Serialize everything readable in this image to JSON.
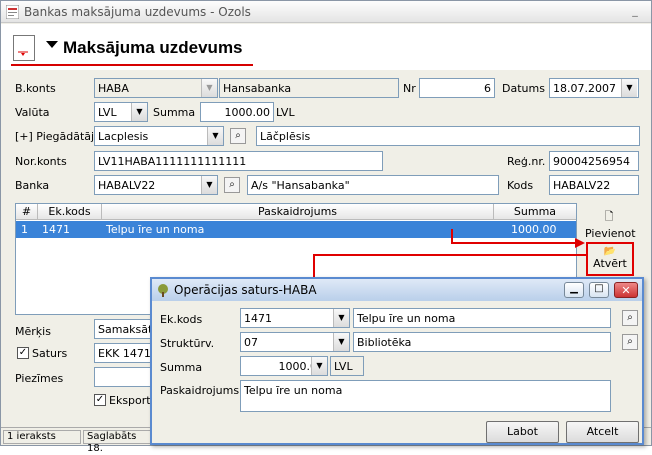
{
  "window": {
    "title": "Bankas maksājuma uzdevums - Ozols"
  },
  "header": {
    "title": "Maksājuma uzdevums"
  },
  "form": {
    "bkonts_label": "B.konts",
    "bkonts_value": "HABA",
    "bank_name": "Hansabanka",
    "nr_label": "Nr",
    "nr_value": "6",
    "datums_label": "Datums",
    "datums_value": "18.07.2007",
    "valuta_label": "Valūta",
    "valuta_value": "LVL",
    "summa_label": "Summa",
    "summa_value": "1000.00",
    "summa_currency": "LVL",
    "piegadatajs_label": "[+] Piegādātājs",
    "piegadatajs_value": "Lacplesis",
    "piegadatajs_name": "Lāčplēsis",
    "norkonts_label": "Nor.konts",
    "norkonts_value": "LV11HABA1111111111111",
    "regnr_label": "Reģ.nr.",
    "regnr_value": "90004256954",
    "banka_label": "Banka",
    "banka_value": "HABALV22",
    "banka_name": "A/s \"Hansabanka\"",
    "kods_label": "Kods",
    "kods_value": "HABALV22",
    "merkis_label": "Mērķis",
    "merkis_value": "Samaksāts",
    "saturs_label": "Saturs",
    "saturs_value": "EKK 1471",
    "piezimes_label": "Piezīmes",
    "eksport_label": "Eksportē"
  },
  "grid": {
    "columns": [
      "#",
      "Ek.kods",
      "Paskaidrojums",
      "Summa"
    ],
    "rows": [
      {
        "num": "1",
        "ekkods": "1471",
        "paskaidrojums": "Telpu īre un noma",
        "summa": "1000.00"
      }
    ]
  },
  "actions": {
    "pievienot": "Pievienot",
    "atvert": "Atvērt"
  },
  "status": {
    "records": "1 ieraksts",
    "saved": "Saglabāts 18."
  },
  "dialog": {
    "title": "Operācijas saturs-HABA",
    "ekkods_label": "Ek.kods",
    "ekkods_value": "1471",
    "ekkods_name": "Telpu īre un noma",
    "struktur_label": "Struktūrv.",
    "struktur_value": "07",
    "struktur_name": "Bibliotēka",
    "summa_label": "Summa",
    "summa_value": "1000.00",
    "summa_currency": "LVL",
    "paskaidrojums_label": "Paskaidrojums",
    "paskaidrojums_value": "Telpu īre un noma",
    "labot": "Labot",
    "atcelt": "Atcelt"
  },
  "colors": {
    "accent_red": "#e00000",
    "selection": "#3a83d8"
  }
}
